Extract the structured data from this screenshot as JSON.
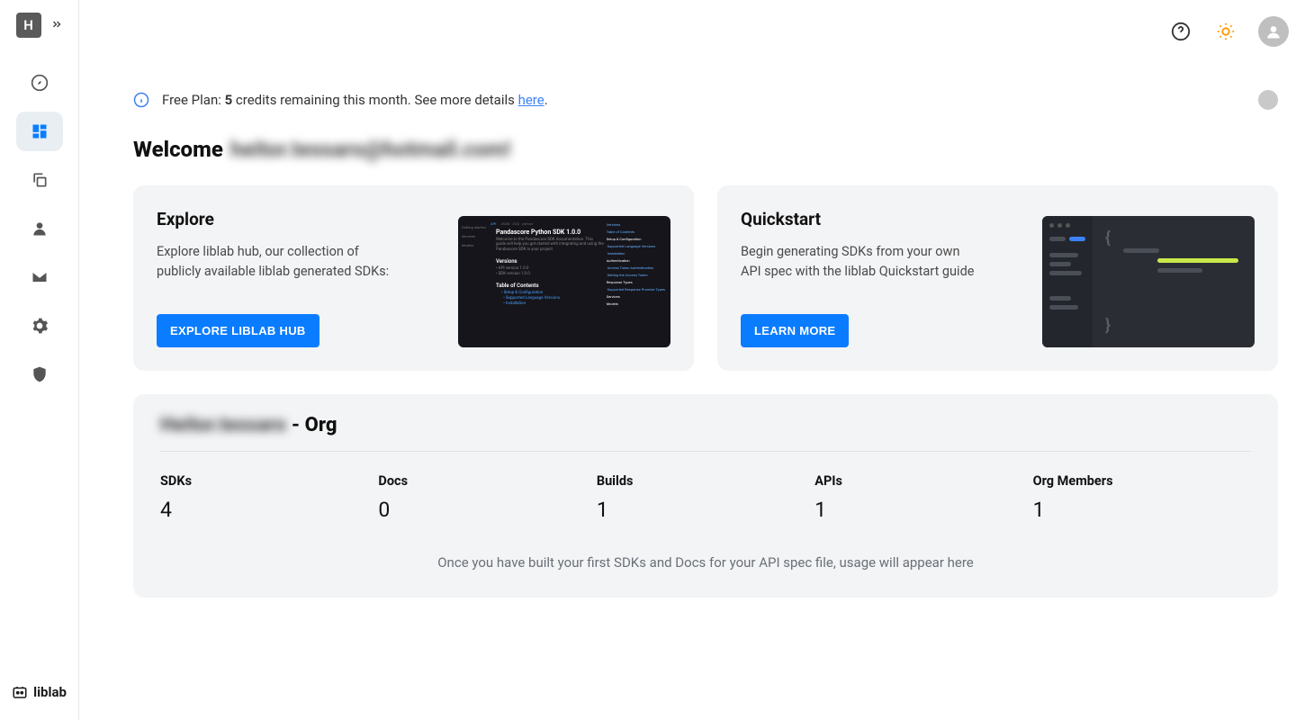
{
  "sidebar": {
    "avatar_letter": "H",
    "brand": "liblab"
  },
  "plan": {
    "prefix": "Free Plan: ",
    "count": "5",
    "mid": " credits remaining this month. See more details ",
    "link": "here",
    "suffix": "."
  },
  "welcome": {
    "label": "Welcome",
    "user": "heitor.tessaro@hotmail.com!"
  },
  "cards": {
    "explore": {
      "title": "Explore",
      "desc": "Explore liblab hub, our collection of publicly available liblab generated SDKs:",
      "button": "EXPLORE LIBLAB HUB",
      "mock": {
        "title": "Pandascore Python SDK 1.0.0",
        "versions": "Versions",
        "toc": "Table of Contents"
      }
    },
    "quickstart": {
      "title": "Quickstart",
      "desc": "Begin generating SDKs from your own API spec with the liblab Quickstart guide",
      "button": "LEARN MORE"
    }
  },
  "org": {
    "name": "Heitor.tessaro",
    "suffix": " - Org",
    "stats": [
      {
        "label": "SDKs",
        "value": "4"
      },
      {
        "label": "Docs",
        "value": "0"
      },
      {
        "label": "Builds",
        "value": "1"
      },
      {
        "label": "APIs",
        "value": "1"
      },
      {
        "label": "Org Members",
        "value": "1"
      }
    ],
    "note": "Once you have built your first SDKs and Docs for your API spec file, usage will appear here"
  }
}
